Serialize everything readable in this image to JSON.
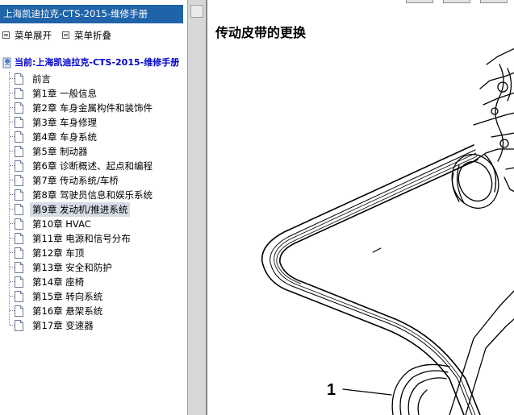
{
  "sidebar": {
    "title": "上海凯迪拉克-CTS-2015-维修手册",
    "expand_label": "菜单展开",
    "collapse_label": "菜单折叠",
    "root_label": "当前:上海凯迪拉克-CTS-2015-维修手册",
    "items": [
      {
        "label": "前言"
      },
      {
        "label": "第1章 一般信息"
      },
      {
        "label": "第2章 车身金属构件和装饰件"
      },
      {
        "label": "第3章 车身修理"
      },
      {
        "label": "第4章 车身系统"
      },
      {
        "label": "第5章 制动器"
      },
      {
        "label": "第6章 诊断概述、起点和编程"
      },
      {
        "label": "第7章 传动系统/车桥"
      },
      {
        "label": "第8章 驾驶员信息和娱乐系统"
      },
      {
        "label": "第9章 发动机/推进系统"
      },
      {
        "label": "第10章 HVAC"
      },
      {
        "label": "第11章 电源和信号分布"
      },
      {
        "label": "第12章 车顶"
      },
      {
        "label": "第13章 安全和防护"
      },
      {
        "label": "第14章 座椅"
      },
      {
        "label": "第15章 转向系统"
      },
      {
        "label": "第16章 悬架系统"
      },
      {
        "label": "第17章 变速器"
      }
    ],
    "selected_index": 9
  },
  "content": {
    "heading": "传动皮带的更换",
    "callout_label": "1"
  },
  "colors": {
    "title_bar": "#1f63a8",
    "root_link": "#0000cc",
    "selected_bg": "#d5dce6"
  }
}
